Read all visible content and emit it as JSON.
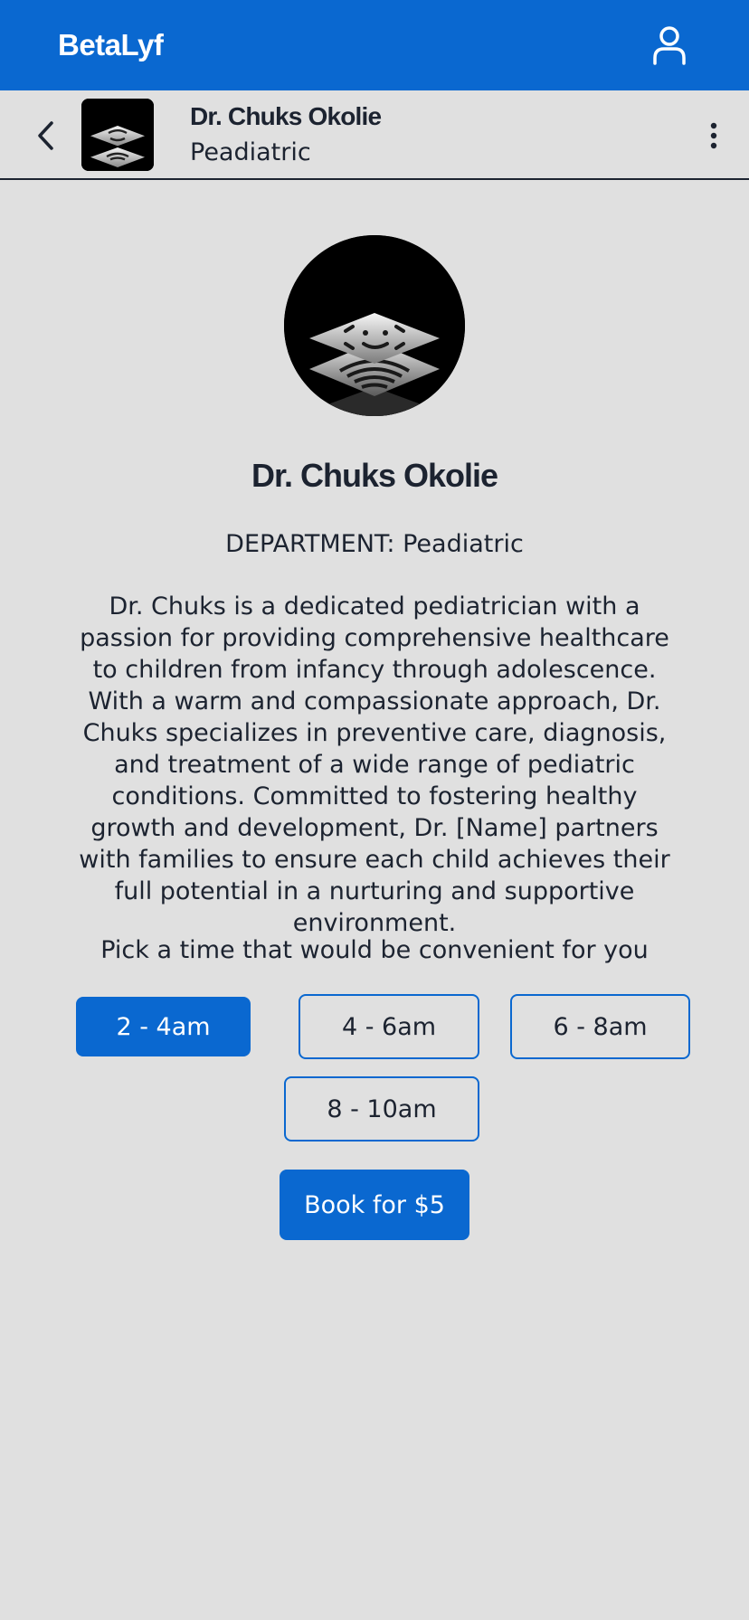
{
  "app": {
    "title": "BetaLyf"
  },
  "header": {
    "doctor_name": "Dr. Chuks Okolie",
    "department": "Peadiatric"
  },
  "profile": {
    "name": "Dr. Chuks Okolie",
    "department_label": "DEPARTMENT:",
    "department_value": "Peadiatric",
    "bio": "Dr. Chuks is a dedicated pediatrician with a passion for providing comprehensive healthcare to children from infancy through adolescence. With a warm and compassionate approach, Dr. Chuks specializes in preventive care, diagnosis, and treatment of a wide range of pediatric conditions. Committed to fostering healthy growth and development, Dr. [Name] partners with families to ensure each child achieves their full potential in a nurturing and supportive environment."
  },
  "booking": {
    "prompt": "Pick a time that would be convenient for you",
    "slots": [
      {
        "label": "2 - 4am",
        "selected": true
      },
      {
        "label": "4 - 6am",
        "selected": false
      },
      {
        "label": "6 - 8am",
        "selected": false
      },
      {
        "label": "8 - 10am",
        "selected": false
      }
    ],
    "book_label": "Book for $5"
  },
  "icons": {
    "profile": "user-icon",
    "back": "chevron-left-icon",
    "more": "more-vertical-icon"
  },
  "colors": {
    "primary": "#0a68d0",
    "background": "#e0e0e0",
    "text": "#1c2330"
  }
}
